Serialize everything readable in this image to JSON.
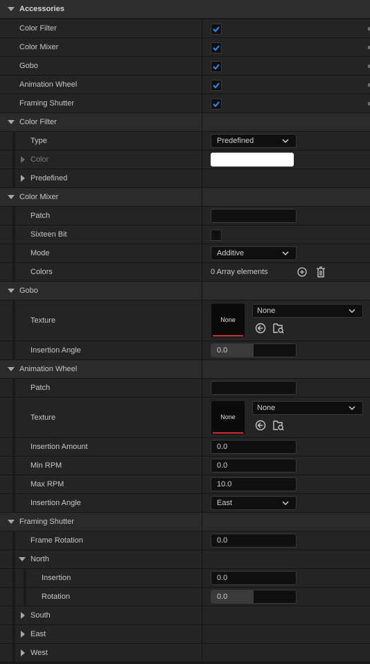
{
  "accessories": {
    "title": "Accessories",
    "items": [
      {
        "label": "Color Filter",
        "checked": true
      },
      {
        "label": "Color Mixer",
        "checked": true
      },
      {
        "label": "Gobo",
        "checked": true
      },
      {
        "label": "Animation Wheel",
        "checked": true
      },
      {
        "label": "Framing Shutter",
        "checked": true
      }
    ]
  },
  "color_filter": {
    "title": "Color Filter",
    "type_label": "Type",
    "type_value": "Predefined",
    "color_label": "Color",
    "color_swatch": "#ffffff",
    "predefined_label": "Predefined"
  },
  "color_mixer": {
    "title": "Color Mixer",
    "patch_label": "Patch",
    "patch_value": "",
    "sixteen_bit_label": "Sixteen Bit",
    "sixteen_bit_checked": false,
    "mode_label": "Mode",
    "mode_value": "Additive",
    "colors_label": "Colors",
    "colors_value": "0 Array elements"
  },
  "gobo": {
    "title": "Gobo",
    "texture_label": "Texture",
    "texture_thumb_text": "None",
    "texture_value": "None",
    "insertion_angle_label": "Insertion Angle",
    "insertion_angle_value": "0.0",
    "insertion_angle_fraction": 0.5
  },
  "animation_wheel": {
    "title": "Animation Wheel",
    "patch_label": "Patch",
    "patch_value": "",
    "texture_label": "Texture",
    "texture_thumb_text": "None",
    "texture_value": "None",
    "insertion_amount_label": "Insertion Amount",
    "insertion_amount_value": "0.0",
    "min_rpm_label": "Min RPM",
    "min_rpm_value": "0.0",
    "max_rpm_label": "Max RPM",
    "max_rpm_value": "10.0",
    "insertion_angle_label": "Insertion Angle",
    "insertion_angle_value": "East"
  },
  "framing_shutter": {
    "title": "Framing Shutter",
    "frame_rotation_label": "Frame Rotation",
    "frame_rotation_value": "0.0",
    "north": {
      "title": "North",
      "insertion_label": "Insertion",
      "insertion_value": "0.0",
      "rotation_label": "Rotation",
      "rotation_value": "0.0",
      "rotation_fraction": 0.5
    },
    "south_title": "South",
    "east_title": "East",
    "west_title": "West"
  },
  "colors": {
    "check": "#2f8fff",
    "accent_red": "#d03030"
  }
}
